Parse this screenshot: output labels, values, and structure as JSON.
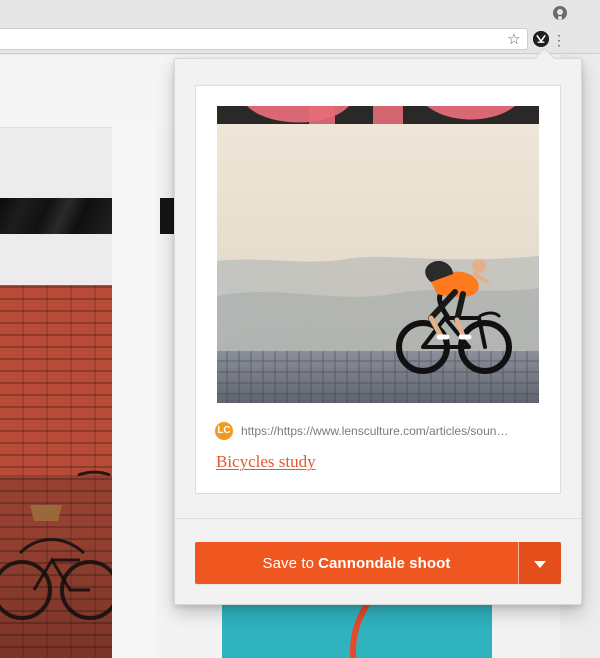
{
  "popup": {
    "source": {
      "badge_text": "LC",
      "url": "https://https://www.lensculture.com/articles/soun…"
    },
    "title": "Bicycles study",
    "save": {
      "prefix": "Save to",
      "target": "Cannondale shoot"
    }
  },
  "icons": {
    "star": "star-icon",
    "extension": "extension-icon",
    "menu": "menu-icon",
    "profile": "profile-icon",
    "dropdown": "chevron-down-icon"
  },
  "colors": {
    "accent": "#f0561f",
    "link": "#e4572e",
    "source_badge": "#f39a1e"
  }
}
